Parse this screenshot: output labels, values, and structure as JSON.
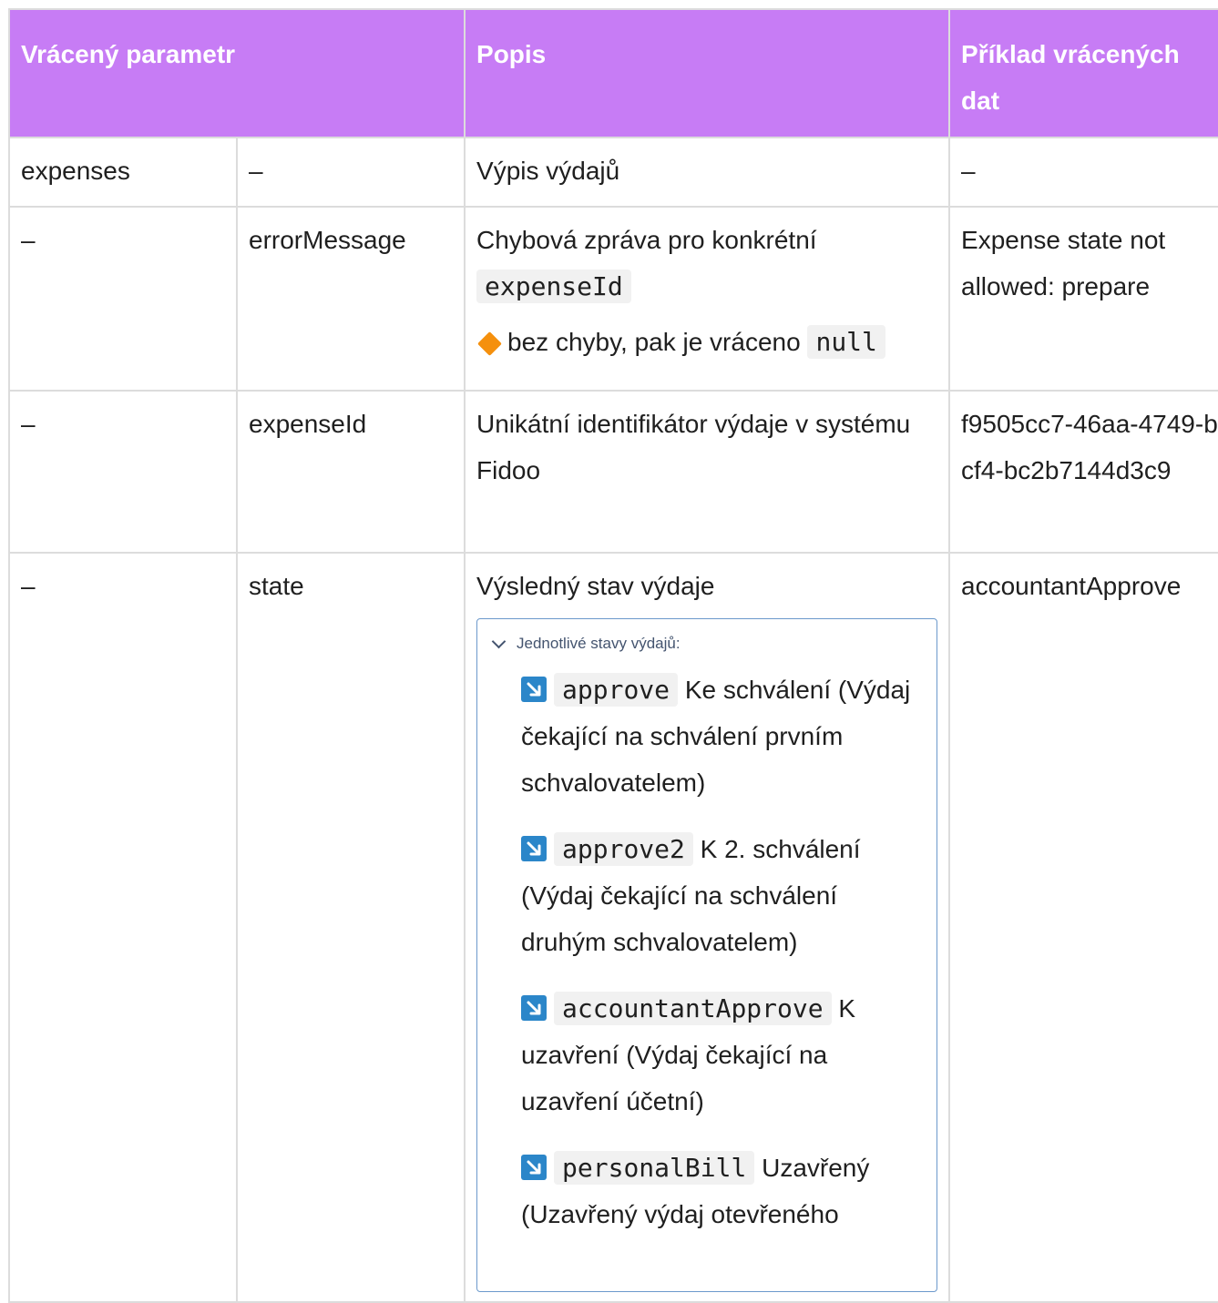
{
  "header": {
    "col_param": "Vrácený parametr",
    "col_desc": "Popis",
    "col_example": "Příklad vrácených dat"
  },
  "rows": [
    {
      "param": "expenses",
      "subparam": "–",
      "desc": "Výpis výdajů",
      "example": "–"
    },
    {
      "param": "–",
      "subparam": "errorMessage",
      "desc_text": "Chybová zpráva pro konkrétní",
      "desc_code": "expenseId",
      "note_text": "bez chyby, pak je vráceno",
      "note_code": "null",
      "note_icon": "orange-diamond-icon",
      "example": "Expense state not allowed: prepare"
    },
    {
      "param": "–",
      "subparam": "expenseId",
      "desc": "Unikátní identifikátor výdaje v systému Fidoo",
      "example": "f9505cc7-46aa-4749-bcf4-bc2b7144d3c9"
    },
    {
      "param": "–",
      "subparam": "state",
      "desc": "Výsledný stav výdaje",
      "example": "accountantApprove",
      "expand": {
        "title": "Jednotlivé stavy výdajů:",
        "icon": "arrow-down-right-icon",
        "items": [
          {
            "code": "approve",
            "text": "Ke schválení (Výdaj čekající na schválení prvním schvalovatelem)"
          },
          {
            "code": "approve2",
            "text": "K 2. schválení (Výdaj čekající na schválení druhým schvalovatelem)"
          },
          {
            "code": "accountantApprove",
            "text": "K uzavření (Výdaj čekající na uzavření účetní)"
          },
          {
            "code": "personalBill",
            "text": "Uzavřený (Uzavřený výdaj otevřeného"
          }
        ]
      }
    }
  ],
  "colors": {
    "header_bg": "#c77cf5",
    "header_text": "#ffffff",
    "border": "#dcdcdc",
    "code_bg": "#f1f1f1",
    "note_icon": "#f5900d",
    "state_icon": "#2b86c9",
    "expand_border": "#6c99cc"
  }
}
